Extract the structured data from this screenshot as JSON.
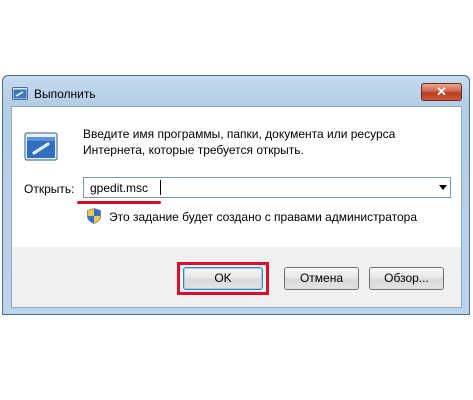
{
  "window": {
    "title": "Выполнить",
    "close_symbol": "✕"
  },
  "description": {
    "line1": "Введите имя программы, папки, документа или ресурса",
    "line2": "Интернета, которые требуется открыть."
  },
  "open_field": {
    "label": "Открыть:",
    "value": "gpedit.msc"
  },
  "admin_note": "Это задание будет создано с правами администратора",
  "buttons": {
    "ok": "OK",
    "cancel": "Отмена",
    "browse": "Обзор..."
  },
  "icons": {
    "title": "run-icon",
    "main": "run-icon",
    "shield": "uac-shield-icon",
    "dropdown": "chevron-down-icon"
  },
  "colors": {
    "highlight": "#d9102a",
    "close_button": "#c84a2e"
  }
}
